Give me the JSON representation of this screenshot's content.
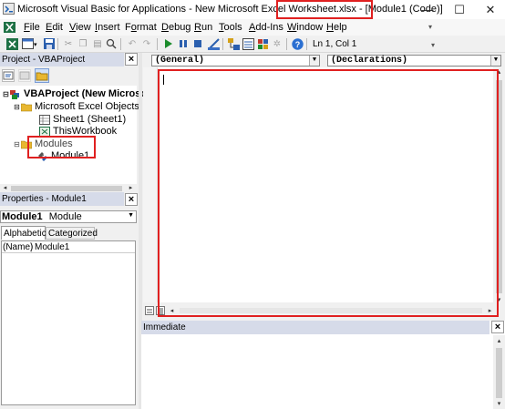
{
  "window": {
    "title": "Microsoft Visual Basic for Applications - New Microsoft Excel Worksheet.xlsx - [Module1 (Code)]",
    "title_prefix": "Microsoft Visual Basic for Applications - New Microsoft Excel Worksheet.xlsx - ",
    "title_highlight": "[Module1 (Code)]",
    "minimize_glyph": "—",
    "maximize_glyph": "☐",
    "close_glyph": "✕"
  },
  "menubar": {
    "items": [
      {
        "label": "File",
        "u": "F",
        "rest": "ile"
      },
      {
        "label": "Edit",
        "u": "E",
        "rest": "dit"
      },
      {
        "label": "View",
        "u": "V",
        "rest": "iew"
      },
      {
        "label": "Insert",
        "u": "I",
        "rest": "nsert"
      },
      {
        "label": "Format",
        "pre": "F",
        "u": "o",
        "rest": "rmat"
      },
      {
        "label": "Debug",
        "u": "D",
        "rest": "ebug"
      },
      {
        "label": "Run",
        "u": "R",
        "rest": "un"
      },
      {
        "label": "Tools",
        "u": "T",
        "rest": "ools"
      },
      {
        "label": "Add-Ins",
        "u": "A",
        "rest": "dd-Ins"
      },
      {
        "label": "Window",
        "u": "W",
        "rest": "indow"
      },
      {
        "label": "Help",
        "u": "H",
        "rest": "elp"
      }
    ]
  },
  "toolbar": {
    "position_label": "Ln 1, Col 1",
    "icons": [
      "excel-icon",
      "insert-module-icon",
      "save-icon",
      "cut-icon",
      "copy-icon",
      "paste-icon",
      "find-icon",
      "undo-icon",
      "redo-icon",
      "run-icon",
      "break-icon",
      "reset-icon",
      "design-mode-icon",
      "project-explorer-icon",
      "properties-icon",
      "object-browser-icon",
      "toolbox-icon",
      "help-icon"
    ]
  },
  "project_panel": {
    "title": "Project - VBAProject",
    "close_label": "×",
    "tree": {
      "root": "VBAProject (New Microsoft",
      "folder_objects": "Microsoft Excel Objects",
      "sheet1": "Sheet1 (Sheet1)",
      "thisworkbook": "ThisWorkbook",
      "folder_modules": "Modules",
      "module1": "Module1"
    }
  },
  "props_panel": {
    "title": "Properties - Module1",
    "close_label": "×",
    "object_name": "Module1",
    "object_type": "Module",
    "tabs": [
      "Alphabetic",
      "Categorized"
    ],
    "rows": [
      {
        "name": "(Name)",
        "value": "Module1"
      }
    ]
  },
  "code_window": {
    "object_combo": "(General)",
    "procedure_combo": "(Declarations)",
    "code_text": ""
  },
  "immediate": {
    "title": "Immediate",
    "close_label": "×"
  },
  "colors": {
    "highlight": "#e02020",
    "panel_header": "#d6dbe9",
    "background": "#f0f0f0"
  }
}
